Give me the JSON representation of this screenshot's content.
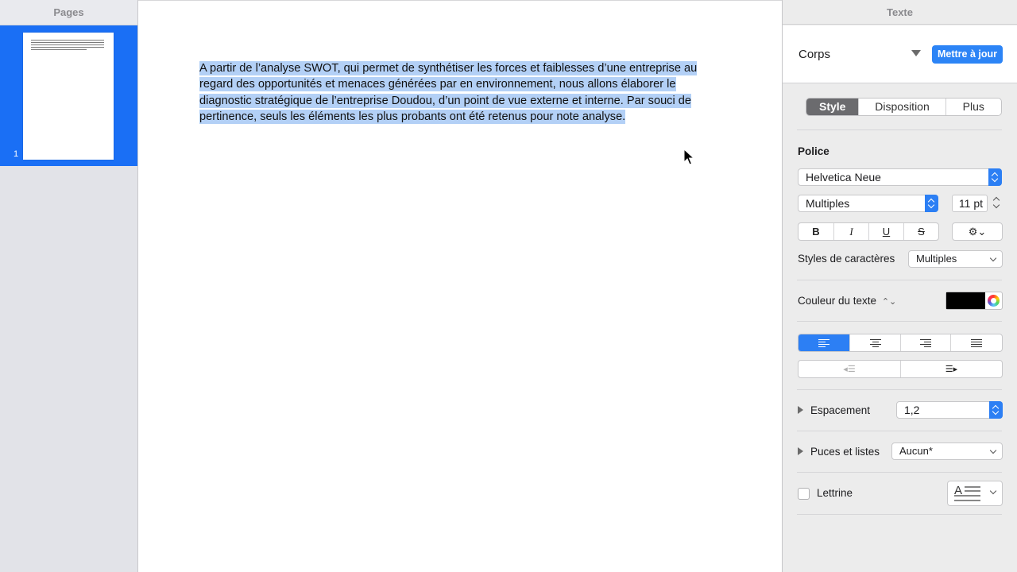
{
  "sidebar": {
    "title": "Pages",
    "pages": [
      {
        "number": "1"
      }
    ]
  },
  "document": {
    "body_text": "A partir de l’analyse SWOT, qui permet de synthétiser les forces et faiblesses d’une entreprise au regard des opportunités et menaces générées par en environnement, nous allons élaborer le diagnostic stratégique de l’entreprise Doudou, d’un point de vue externe et interne. Par souci de pertinence, seuls les éléments les plus probants ont été retenus pour note analyse.",
    "selected": true
  },
  "inspector": {
    "title": "Texte",
    "paragraph_style": "Corps",
    "update_button": "Mettre à jour",
    "tabs": [
      {
        "label": "Style",
        "active": true
      },
      {
        "label": "Disposition",
        "active": false
      },
      {
        "label": "Plus",
        "active": false
      }
    ],
    "font": {
      "section_label": "Police",
      "family": "Helvetica Neue",
      "typeface": "Multiples",
      "size": "11 pt",
      "bold": "B",
      "italic": "I",
      "underline": "U",
      "strike": "S"
    },
    "char_styles": {
      "label": "Styles de caractères",
      "value": "Multiples"
    },
    "text_color": {
      "label": "Couleur du texte",
      "color": "#000000"
    },
    "alignment": {
      "active": "left",
      "options": [
        "left",
        "center",
        "right",
        "justify"
      ]
    },
    "spacing": {
      "label": "Espacement",
      "value": "1,2"
    },
    "bullets": {
      "label": "Puces et listes",
      "value": "Aucun*"
    },
    "dropcap": {
      "label": "Lettrine",
      "icon_letter": "A",
      "checked": false
    }
  },
  "colors": {
    "accent": "#2c7ff4",
    "selection": "#b3d0f6",
    "sidebar_selected": "#1a6ff5"
  }
}
